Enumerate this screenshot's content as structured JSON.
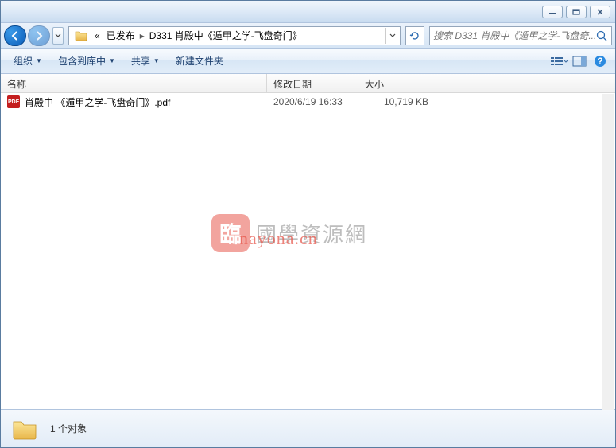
{
  "window_controls": {
    "minimize": "min",
    "maximize": "max",
    "close": "close"
  },
  "breadcrumb": {
    "prefix": "«",
    "items": [
      "已发布",
      "D331 肖殿中《遁甲之学-飞盘奇门》"
    ]
  },
  "search": {
    "placeholder": "搜索 D331 肖殿中《遁甲之学-飞盘奇..."
  },
  "toolbar": {
    "organize": "组织",
    "include": "包含到库中",
    "share": "共享",
    "newfolder": "新建文件夹"
  },
  "columns": {
    "name": "名称",
    "date": "修改日期",
    "size": "大小"
  },
  "files": [
    {
      "icon": "PDF",
      "name": "肖殿中 《遁甲之学-飞盘奇门》.pdf",
      "date": "2020/6/19 16:33",
      "size": "10,719 KB"
    }
  ],
  "status": {
    "text": "1 个对象"
  },
  "watermark": {
    "badge": "臨",
    "text1": "國學資源網",
    "text2": "nayona.cn"
  }
}
